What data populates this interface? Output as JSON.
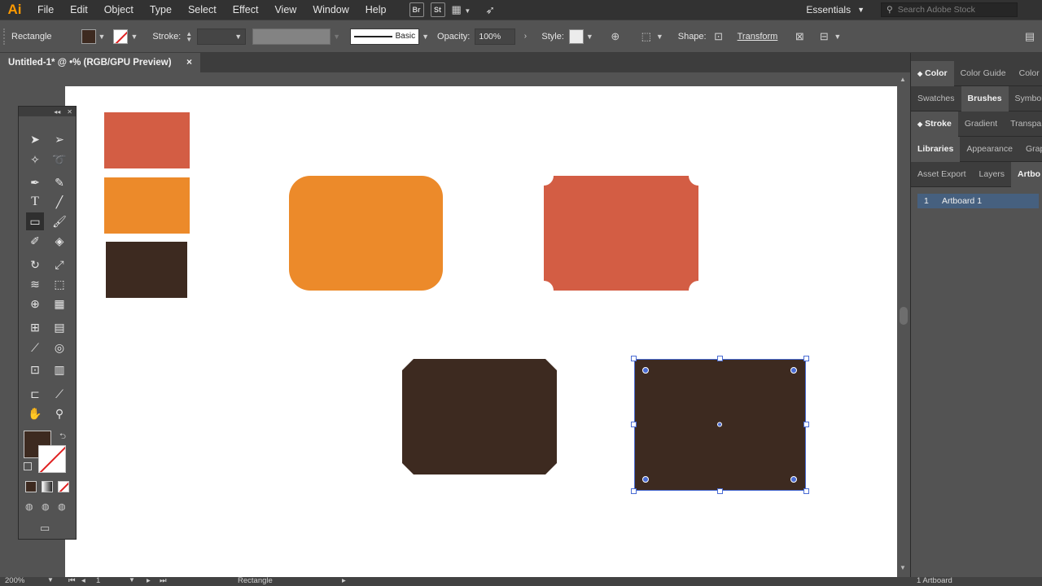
{
  "app": {
    "logo_text": "Ai"
  },
  "menu": [
    "File",
    "Edit",
    "Object",
    "Type",
    "Select",
    "Effect",
    "View",
    "Window",
    "Help"
  ],
  "menubar_icons": {
    "bridge": "Br",
    "stock": "St"
  },
  "workspace": {
    "label": "Essentials"
  },
  "search": {
    "placeholder": "Search Adobe Stock"
  },
  "control_bar": {
    "tool_name": "Rectangle",
    "stroke_label": "Stroke:",
    "stroke_style": "Basic",
    "opacity_label": "Opacity:",
    "opacity_value": "100%",
    "style_label": "Style:",
    "shape_label": "Shape:",
    "transform_label": "Transform"
  },
  "document_tab": {
    "title": "Untitled-1* @ ⁠•% (RGB/GPU Preview)",
    "close": "×"
  },
  "canvas": {
    "artboard_color": "#ffffff",
    "shapes": [
      {
        "name": "swatch-red",
        "color": "#d35d44"
      },
      {
        "name": "swatch-orange",
        "color": "#ec8a2a"
      },
      {
        "name": "swatch-brown",
        "color": "#3d2a20"
      },
      {
        "name": "rounded-rect-orange",
        "color": "#ec8a2a",
        "corner": "round"
      },
      {
        "name": "inverted-rect-red",
        "color": "#d35d44",
        "corner": "inverted"
      },
      {
        "name": "chamfer-rect-brown",
        "color": "#3d2a20",
        "corner": "chamfer"
      },
      {
        "name": "selected-rect-brown",
        "color": "#3d2a20",
        "corner": "square",
        "selected": true
      }
    ],
    "selection_color": "#4a6cd4"
  },
  "right_panel": {
    "tab_rows": [
      [
        {
          "label": "Color",
          "active": true
        },
        {
          "label": "Color Guide"
        },
        {
          "label": "Color"
        }
      ],
      [
        {
          "label": "Swatches"
        },
        {
          "label": "Brushes",
          "active": true
        },
        {
          "label": "Symbol"
        }
      ],
      [
        {
          "label": "Stroke",
          "active": true
        },
        {
          "label": "Gradient"
        },
        {
          "label": "Transpa"
        }
      ],
      [
        {
          "label": "Libraries",
          "active": true
        },
        {
          "label": "Appearance"
        },
        {
          "label": "Graph"
        }
      ],
      [
        {
          "label": "Asset Export"
        },
        {
          "label": "Layers"
        },
        {
          "label": "Artbo",
          "active": true
        }
      ]
    ],
    "artboard_row": {
      "index": "1",
      "name": "Artboard 1"
    },
    "footer": "1 Artboard"
  },
  "status_bar": {
    "zoom": "200%",
    "artboard_num": "1",
    "tool": "Rectangle"
  }
}
